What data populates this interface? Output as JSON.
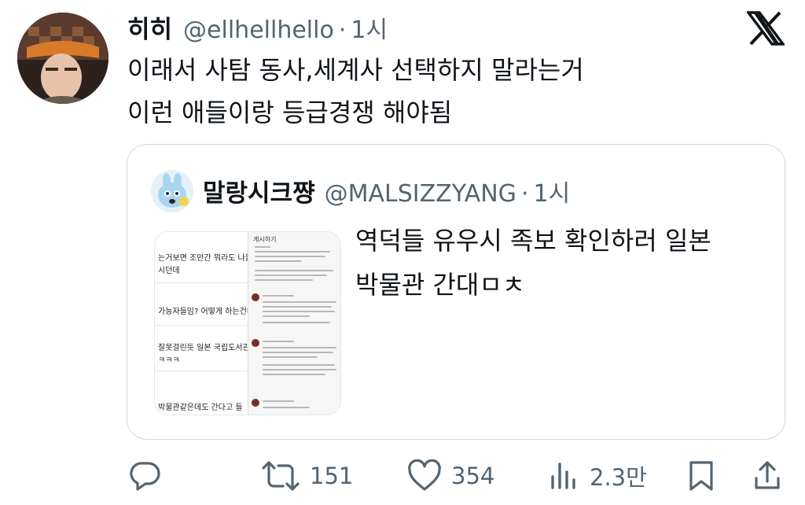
{
  "tweet": {
    "display_name": "히히",
    "handle": "@ellhellhello",
    "separator": "·",
    "time": "1시",
    "text_lines": [
      "이래서 사탐 동사,세계사 선택하지 말라는거",
      "이런 애들이랑 등급경쟁 해야됨"
    ]
  },
  "quote": {
    "display_name": "말랑시크쨩",
    "handle": "@MALSIZZYANG",
    "separator": "·",
    "time": "1시",
    "text_lines": [
      "역덕들 유우시 족보 확인하러 일본",
      "박물관 간대ㅁㅊ"
    ],
    "media": {
      "left_rows": [
        "는거보면 조만간 뭐라도 나올듯",
        "시던데",
        "가능자들임? 어떻게 하는건데",
        "잘못걸린듯 일본 국립도서관들",
        "ㅋㅋㅋ",
        "박물관같은데도 간다고 들"
      ],
      "right_title": "게시하기"
    }
  },
  "actions": {
    "reply": {
      "icon": "reply-icon"
    },
    "retweet": {
      "icon": "retweet-icon",
      "count": "151"
    },
    "like": {
      "icon": "heart-icon",
      "count": "354"
    },
    "views": {
      "icon": "views-icon",
      "count": "2.3만"
    },
    "bookmark": {
      "icon": "bookmark-icon"
    },
    "share": {
      "icon": "share-icon"
    }
  }
}
